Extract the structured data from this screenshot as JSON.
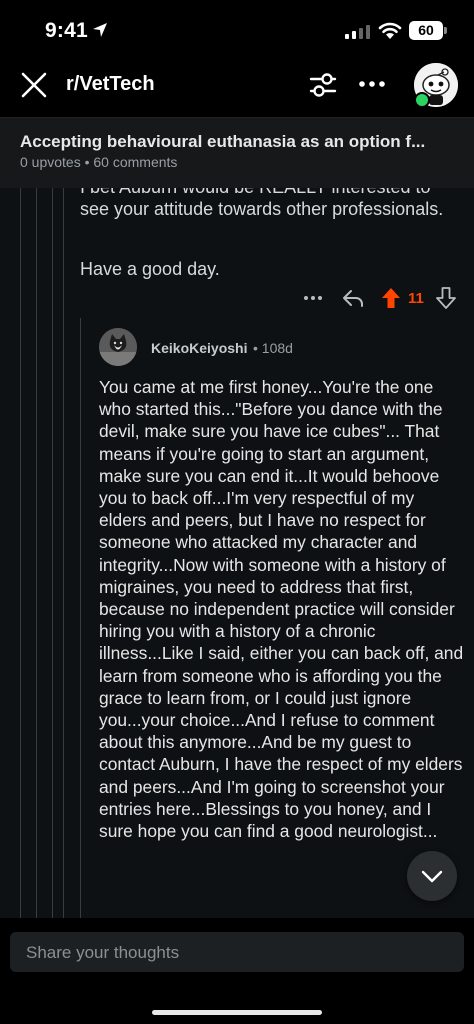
{
  "status": {
    "time": "9:41",
    "battery": "60"
  },
  "nav": {
    "subreddit": "r/VetTech"
  },
  "post": {
    "title": "Accepting behavioural euthanasia as an option f...",
    "meta": "0 upvotes • 60 comments"
  },
  "parent_comment": {
    "cut_line": "I bet Auburn would be REALLY interested to",
    "paragraph1": "see your attitude towards other professionals.",
    "paragraph2": "Have a good day.",
    "score": "11"
  },
  "reply": {
    "username": "KeikoKeiyoshi",
    "age": "• 108d",
    "body": "You came at me first honey...You're the one who started this...\"Before you dance with the devil, make sure you have ice cubes\"... That means if you're going to start an argument, make sure you can end it...It would behoove you to back off...I'm very respectful of my elders and peers, but I have no respect for someone who attacked my character and integrity...Now with someone with a history of migraines, you need to address that first, because no independent practice will consider hiring you with a history of a chronic illness...Like I said, either you can back off, and learn from someone who is affording you the grace to learn from, or I could just ignore you...your choice...And I refuse to comment about this anymore...And be my guest to contact Auburn, I have the respect of my elders and peers...And I'm going to screenshot your entries here...Blessings to you honey, and I sure hope you can find a good neurologist..."
  },
  "composer": {
    "placeholder": "Share your thoughts"
  },
  "colors": {
    "upvote": "#ff4500",
    "background": "#0e1113",
    "text": "#d7dadc"
  }
}
